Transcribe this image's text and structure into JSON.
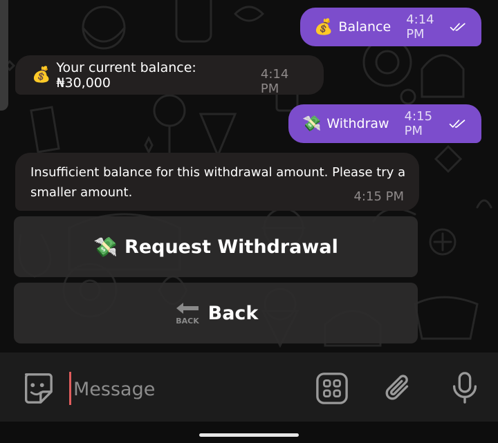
{
  "messages": [
    {
      "direction": "outgoing",
      "emoji": "💰",
      "text": "Balance",
      "time": "4:14 PM",
      "read": true
    },
    {
      "direction": "incoming",
      "emoji": "💰",
      "text": "Your current balance: ₦30,000",
      "time": "4:14 PM"
    },
    {
      "direction": "outgoing",
      "emoji": "💸",
      "text": "Withdraw",
      "time": "4:15 PM",
      "read": true
    },
    {
      "direction": "incoming",
      "text": "Insufficient balance for this withdrawal amount. Please try a smaller amount.",
      "time": "4:15 PM"
    }
  ],
  "keyboard": {
    "buttons": [
      {
        "emoji": "💸",
        "label": "Request Withdrawal"
      },
      {
        "icon": "back-arrow-icon",
        "icon_text": "BACK",
        "label": "Back"
      }
    ]
  },
  "composer": {
    "placeholder": "Message",
    "icons": [
      "sticker-icon",
      "bot-menu-grid-icon",
      "attach-paperclip-icon",
      "microphone-icon"
    ]
  },
  "colors": {
    "outgoing_bubble": "#7c4dcc",
    "incoming_bubble": "#232020",
    "background": "#0e0e0e",
    "input_bar": "#1c1c1c",
    "caret": "#e05d5d"
  }
}
